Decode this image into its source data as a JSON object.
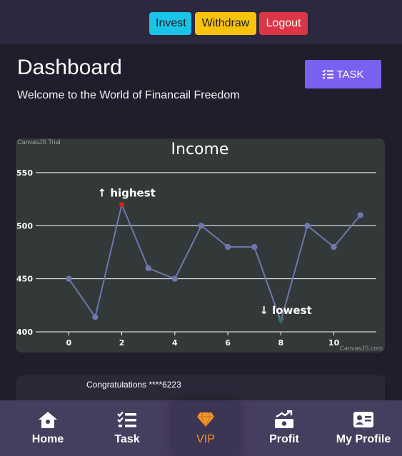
{
  "header": {
    "invest_label": "Invest",
    "withdraw_label": "Withdraw",
    "logout_label": "Logout"
  },
  "main": {
    "title": "Dashboard",
    "welcome": "Welcome to the World of Financail Freedom",
    "task_label": "TASK"
  },
  "chart": {
    "trial_watermark": "CanvasJS Trial",
    "credit": "CanvasJS.com"
  },
  "chart_data": {
    "type": "line",
    "title": "Income",
    "x": [
      0,
      1,
      2,
      3,
      4,
      5,
      6,
      7,
      8,
      9,
      10,
      11
    ],
    "y": [
      450,
      414,
      520,
      460,
      450,
      500,
      480,
      480,
      410,
      500,
      480,
      510
    ],
    "xlim": [
      -0.6,
      11.6
    ],
    "ylim": [
      400,
      558
    ],
    "x_ticks": [
      0,
      2,
      4,
      6,
      8,
      10
    ],
    "y_ticks": [
      400,
      450,
      500,
      550
    ],
    "grid": true,
    "line_color": "#6d78ad",
    "annotations": [
      {
        "index": 2,
        "label": "↑ highest",
        "marker_color": "#e01c1c"
      },
      {
        "index": 8,
        "label": "↓ lowest",
        "marker_color": "#3a6b65"
      }
    ]
  },
  "congrats": {
    "text": "Congratulations ****6223"
  },
  "nav": {
    "home": "Home",
    "task": "Task",
    "vip": "VIP",
    "profit": "Profit",
    "profile": "My Profile"
  },
  "colors": {
    "background": "#201d2c",
    "topbar": "#2c283d",
    "invest": "#1ac3e8",
    "withdraw": "#f9c20b",
    "logout": "#dc3545",
    "task_button": "#7a60f0",
    "vip_accent": "#f2962b",
    "nav_bar": "#463e5e"
  }
}
